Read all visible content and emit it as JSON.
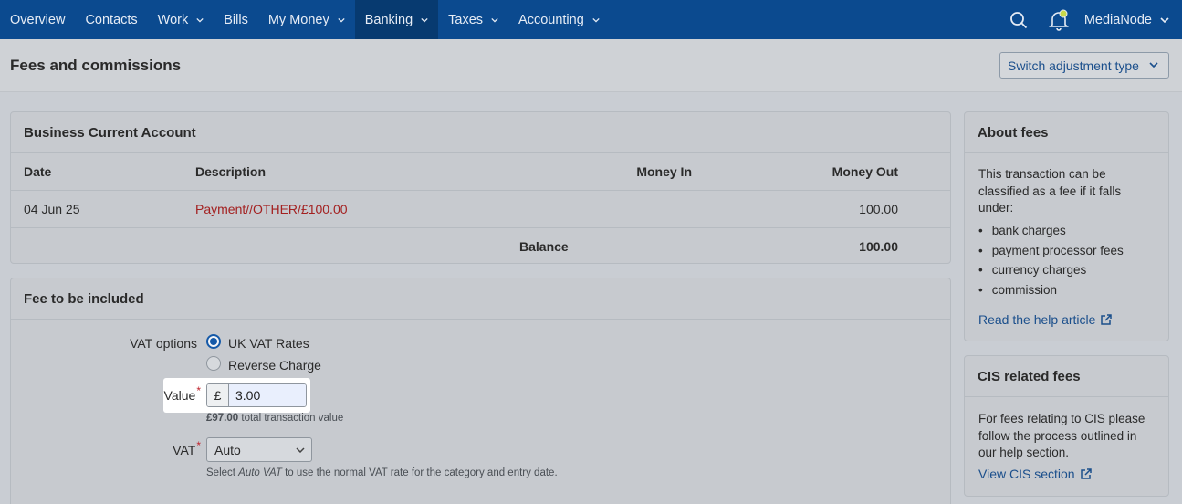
{
  "nav": {
    "items": [
      {
        "label": "Overview",
        "dropdown": false
      },
      {
        "label": "Contacts",
        "dropdown": false
      },
      {
        "label": "Work",
        "dropdown": true
      },
      {
        "label": "Bills",
        "dropdown": false
      },
      {
        "label": "My Money",
        "dropdown": true
      },
      {
        "label": "Banking",
        "dropdown": true,
        "active": true
      },
      {
        "label": "Taxes",
        "dropdown": true
      },
      {
        "label": "Accounting",
        "dropdown": true
      }
    ],
    "account_label": "MediaNode",
    "icons": [
      "search-icon",
      "bell-icon",
      "chevron-down-icon"
    ]
  },
  "header": {
    "title": "Fees and commissions",
    "switch_button": "Switch adjustment type"
  },
  "account_panel": {
    "title": "Business Current Account",
    "columns": [
      "Date",
      "Description",
      "Money In",
      "Money Out"
    ],
    "rows": [
      {
        "date": "04 Jun 25",
        "description": "Payment//OTHER/£100.00",
        "money_in": "",
        "money_out": "100.00"
      }
    ],
    "balance_label": "Balance",
    "balance_value": "100.00"
  },
  "fee_panel": {
    "title": "Fee to be included",
    "vat_options_label": "VAT options",
    "vat_options": [
      {
        "label": "UK VAT Rates",
        "selected": true
      },
      {
        "label": "Reverse Charge",
        "selected": false
      }
    ],
    "value_label": "Value",
    "currency_symbol": "£",
    "value": "3.00",
    "total_amount": "£97.00",
    "total_text": "total transaction value",
    "vat_label": "VAT",
    "vat_selected": "Auto",
    "vat_hint_prefix": "Select",
    "vat_hint_em": "Auto VAT",
    "vat_hint_suffix": "to use the normal VAT rate for the category and entry date."
  },
  "about_fees": {
    "title": "About fees",
    "intro": "This transaction can be classified as a fee if it falls under:",
    "bullets": [
      "bank charges",
      "payment processor fees",
      "currency charges",
      "commission"
    ],
    "link": "Read the help article"
  },
  "cis_fees": {
    "title": "CIS related fees",
    "text": "For fees relating to CIS please follow the process outlined in our help section.",
    "link": "View CIS section"
  },
  "colors": {
    "nav_bg": "#0b4a8f",
    "nav_active_bg": "#073a70",
    "link": "#1b4f8c",
    "description_red": "#a32020",
    "required_star": "#c0262f",
    "radio_selected": "#1559a8"
  }
}
